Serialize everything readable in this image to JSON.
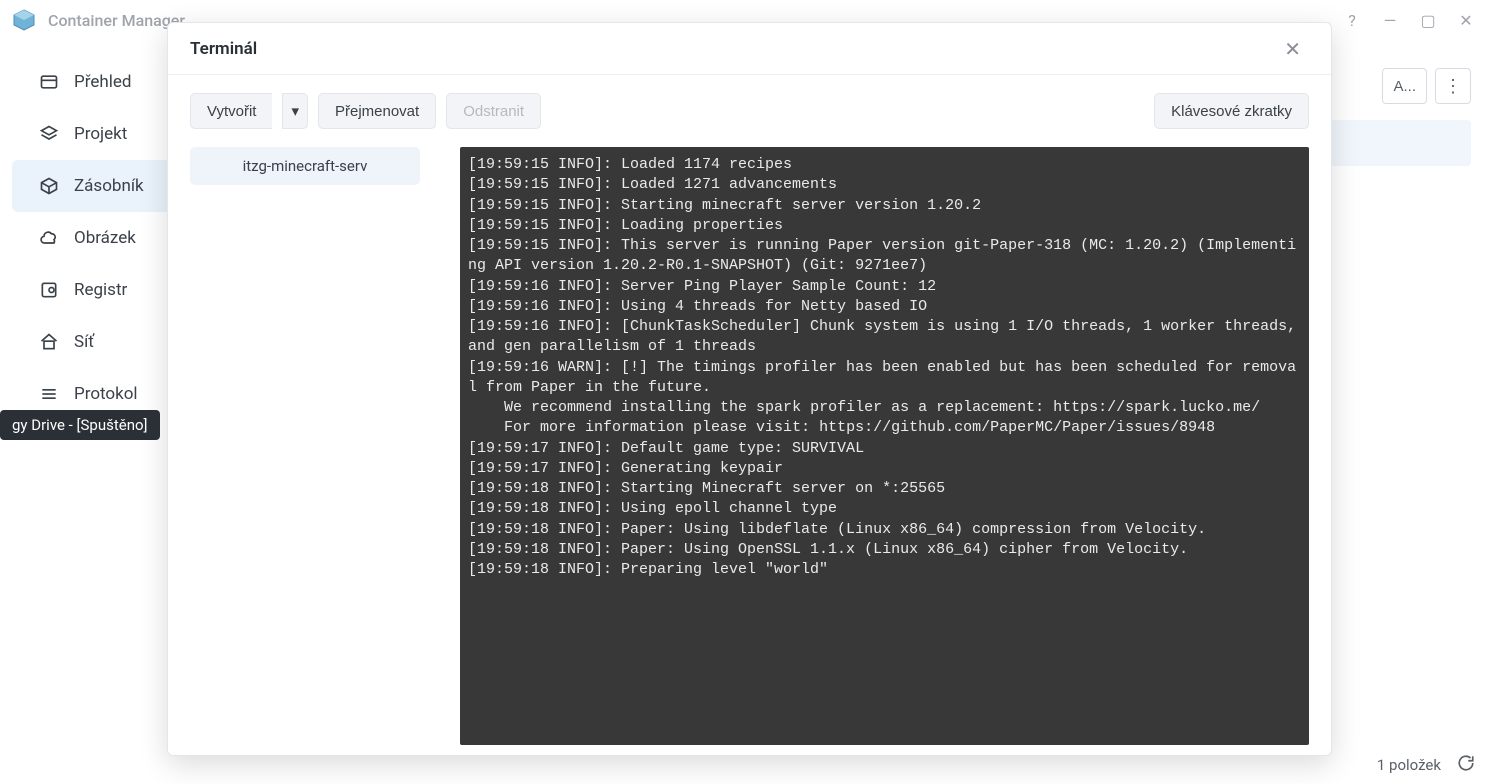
{
  "window": {
    "title": "Container Manager",
    "controls": {
      "help": "?",
      "min": "—",
      "max": "▢",
      "close": "✕"
    }
  },
  "sidebar": {
    "items": [
      {
        "label": "Přehled"
      },
      {
        "label": "Projekt"
      },
      {
        "label": "Zásobník"
      },
      {
        "label": "Obrázek"
      },
      {
        "label": "Registr"
      },
      {
        "label": "Síť"
      },
      {
        "label": "Protokol"
      }
    ]
  },
  "main": {
    "az_label": "A...",
    "status": "1 položek"
  },
  "modal": {
    "title": "Terminál",
    "buttons": {
      "create": "Vytvořit",
      "rename": "Přejmenovat",
      "delete": "Odstranit",
      "shortcuts": "Klávesové zkratky"
    },
    "tab_label": "itzg-minecraft-serv",
    "terminal_output": "[19:59:15 INFO]: Loaded 1174 recipes\n[19:59:15 INFO]: Loaded 1271 advancements\n[19:59:15 INFO]: Starting minecraft server version 1.20.2\n[19:59:15 INFO]: Loading properties\n[19:59:15 INFO]: This server is running Paper version git-Paper-318 (MC: 1.20.2) (Implementing API version 1.20.2-R0.1-SNAPSHOT) (Git: 9271ee7)\n[19:59:16 INFO]: Server Ping Player Sample Count: 12\n[19:59:16 INFO]: Using 4 threads for Netty based IO\n[19:59:16 INFO]: [ChunkTaskScheduler] Chunk system is using 1 I/O threads, 1 worker threads, and gen parallelism of 1 threads\n[19:59:16 WARN]: [!] The timings profiler has been enabled but has been scheduled for removal from Paper in the future.\n    We recommend installing the spark profiler as a replacement: https://spark.lucko.me/\n    For more information please visit: https://github.com/PaperMC/Paper/issues/8948\n[19:59:17 INFO]: Default game type: SURVIVAL\n[19:59:17 INFO]: Generating keypair\n[19:59:18 INFO]: Starting Minecraft server on *:25565\n[19:59:18 INFO]: Using epoll channel type\n[19:59:18 INFO]: Paper: Using libdeflate (Linux x86_64) compression from Velocity.\n[19:59:18 INFO]: Paper: Using OpenSSL 1.1.x (Linux x86_64) cipher from Velocity.\n[19:59:18 INFO]: Preparing level \"world\""
  },
  "tooltip": {
    "text": "gy Drive - [Spuštěno]"
  }
}
